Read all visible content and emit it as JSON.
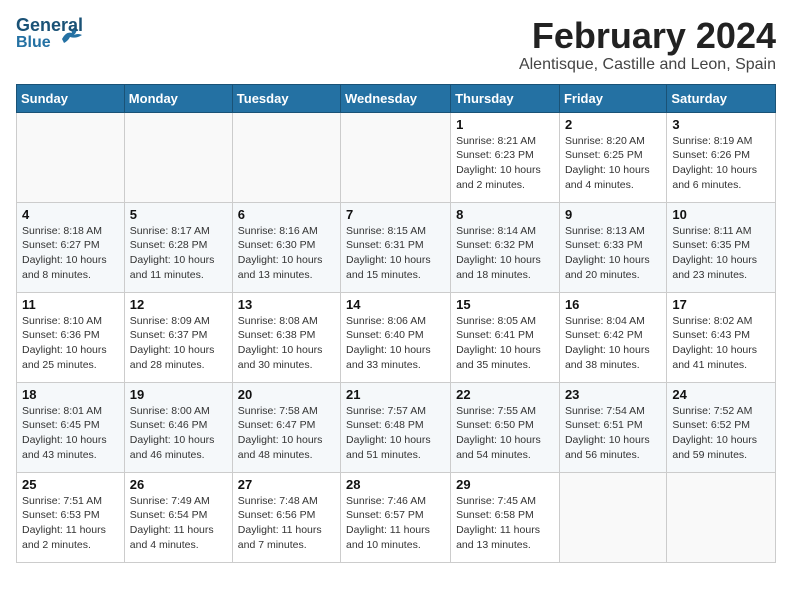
{
  "header": {
    "logo_general": "General",
    "logo_blue": "Blue",
    "month": "February 2024",
    "location": "Alentisque, Castille and Leon, Spain"
  },
  "weekdays": [
    "Sunday",
    "Monday",
    "Tuesday",
    "Wednesday",
    "Thursday",
    "Friday",
    "Saturday"
  ],
  "weeks": [
    [
      {
        "day": "",
        "sunrise": "",
        "sunset": "",
        "daylight": ""
      },
      {
        "day": "",
        "sunrise": "",
        "sunset": "",
        "daylight": ""
      },
      {
        "day": "",
        "sunrise": "",
        "sunset": "",
        "daylight": ""
      },
      {
        "day": "",
        "sunrise": "",
        "sunset": "",
        "daylight": ""
      },
      {
        "day": "1",
        "sunrise": "Sunrise: 8:21 AM",
        "sunset": "Sunset: 6:23 PM",
        "daylight": "Daylight: 10 hours and 2 minutes."
      },
      {
        "day": "2",
        "sunrise": "Sunrise: 8:20 AM",
        "sunset": "Sunset: 6:25 PM",
        "daylight": "Daylight: 10 hours and 4 minutes."
      },
      {
        "day": "3",
        "sunrise": "Sunrise: 8:19 AM",
        "sunset": "Sunset: 6:26 PM",
        "daylight": "Daylight: 10 hours and 6 minutes."
      }
    ],
    [
      {
        "day": "4",
        "sunrise": "Sunrise: 8:18 AM",
        "sunset": "Sunset: 6:27 PM",
        "daylight": "Daylight: 10 hours and 8 minutes."
      },
      {
        "day": "5",
        "sunrise": "Sunrise: 8:17 AM",
        "sunset": "Sunset: 6:28 PM",
        "daylight": "Daylight: 10 hours and 11 minutes."
      },
      {
        "day": "6",
        "sunrise": "Sunrise: 8:16 AM",
        "sunset": "Sunset: 6:30 PM",
        "daylight": "Daylight: 10 hours and 13 minutes."
      },
      {
        "day": "7",
        "sunrise": "Sunrise: 8:15 AM",
        "sunset": "Sunset: 6:31 PM",
        "daylight": "Daylight: 10 hours and 15 minutes."
      },
      {
        "day": "8",
        "sunrise": "Sunrise: 8:14 AM",
        "sunset": "Sunset: 6:32 PM",
        "daylight": "Daylight: 10 hours and 18 minutes."
      },
      {
        "day": "9",
        "sunrise": "Sunrise: 8:13 AM",
        "sunset": "Sunset: 6:33 PM",
        "daylight": "Daylight: 10 hours and 20 minutes."
      },
      {
        "day": "10",
        "sunrise": "Sunrise: 8:11 AM",
        "sunset": "Sunset: 6:35 PM",
        "daylight": "Daylight: 10 hours and 23 minutes."
      }
    ],
    [
      {
        "day": "11",
        "sunrise": "Sunrise: 8:10 AM",
        "sunset": "Sunset: 6:36 PM",
        "daylight": "Daylight: 10 hours and 25 minutes."
      },
      {
        "day": "12",
        "sunrise": "Sunrise: 8:09 AM",
        "sunset": "Sunset: 6:37 PM",
        "daylight": "Daylight: 10 hours and 28 minutes."
      },
      {
        "day": "13",
        "sunrise": "Sunrise: 8:08 AM",
        "sunset": "Sunset: 6:38 PM",
        "daylight": "Daylight: 10 hours and 30 minutes."
      },
      {
        "day": "14",
        "sunrise": "Sunrise: 8:06 AM",
        "sunset": "Sunset: 6:40 PM",
        "daylight": "Daylight: 10 hours and 33 minutes."
      },
      {
        "day": "15",
        "sunrise": "Sunrise: 8:05 AM",
        "sunset": "Sunset: 6:41 PM",
        "daylight": "Daylight: 10 hours and 35 minutes."
      },
      {
        "day": "16",
        "sunrise": "Sunrise: 8:04 AM",
        "sunset": "Sunset: 6:42 PM",
        "daylight": "Daylight: 10 hours and 38 minutes."
      },
      {
        "day": "17",
        "sunrise": "Sunrise: 8:02 AM",
        "sunset": "Sunset: 6:43 PM",
        "daylight": "Daylight: 10 hours and 41 minutes."
      }
    ],
    [
      {
        "day": "18",
        "sunrise": "Sunrise: 8:01 AM",
        "sunset": "Sunset: 6:45 PM",
        "daylight": "Daylight: 10 hours and 43 minutes."
      },
      {
        "day": "19",
        "sunrise": "Sunrise: 8:00 AM",
        "sunset": "Sunset: 6:46 PM",
        "daylight": "Daylight: 10 hours and 46 minutes."
      },
      {
        "day": "20",
        "sunrise": "Sunrise: 7:58 AM",
        "sunset": "Sunset: 6:47 PM",
        "daylight": "Daylight: 10 hours and 48 minutes."
      },
      {
        "day": "21",
        "sunrise": "Sunrise: 7:57 AM",
        "sunset": "Sunset: 6:48 PM",
        "daylight": "Daylight: 10 hours and 51 minutes."
      },
      {
        "day": "22",
        "sunrise": "Sunrise: 7:55 AM",
        "sunset": "Sunset: 6:50 PM",
        "daylight": "Daylight: 10 hours and 54 minutes."
      },
      {
        "day": "23",
        "sunrise": "Sunrise: 7:54 AM",
        "sunset": "Sunset: 6:51 PM",
        "daylight": "Daylight: 10 hours and 56 minutes."
      },
      {
        "day": "24",
        "sunrise": "Sunrise: 7:52 AM",
        "sunset": "Sunset: 6:52 PM",
        "daylight": "Daylight: 10 hours and 59 minutes."
      }
    ],
    [
      {
        "day": "25",
        "sunrise": "Sunrise: 7:51 AM",
        "sunset": "Sunset: 6:53 PM",
        "daylight": "Daylight: 11 hours and 2 minutes."
      },
      {
        "day": "26",
        "sunrise": "Sunrise: 7:49 AM",
        "sunset": "Sunset: 6:54 PM",
        "daylight": "Daylight: 11 hours and 4 minutes."
      },
      {
        "day": "27",
        "sunrise": "Sunrise: 7:48 AM",
        "sunset": "Sunset: 6:56 PM",
        "daylight": "Daylight: 11 hours and 7 minutes."
      },
      {
        "day": "28",
        "sunrise": "Sunrise: 7:46 AM",
        "sunset": "Sunset: 6:57 PM",
        "daylight": "Daylight: 11 hours and 10 minutes."
      },
      {
        "day": "29",
        "sunrise": "Sunrise: 7:45 AM",
        "sunset": "Sunset: 6:58 PM",
        "daylight": "Daylight: 11 hours and 13 minutes."
      },
      {
        "day": "",
        "sunrise": "",
        "sunset": "",
        "daylight": ""
      },
      {
        "day": "",
        "sunrise": "",
        "sunset": "",
        "daylight": ""
      }
    ]
  ]
}
